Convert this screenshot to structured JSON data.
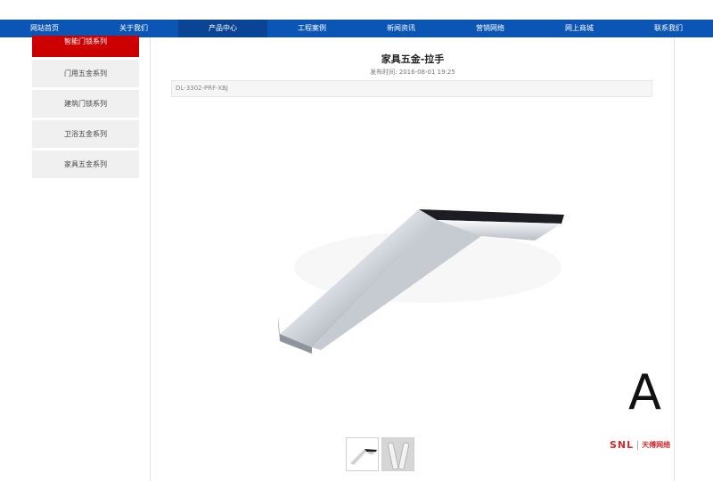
{
  "nav": {
    "items": [
      "网站首页",
      "关于我们",
      "产品中心",
      "工程案例",
      "新闻资讯",
      "营销网络",
      "网上商城",
      "联系我们"
    ],
    "active_index": 2
  },
  "sidebar": {
    "items": [
      {
        "label": "智能门锁系列",
        "active": true
      },
      {
        "label": "门用五金系列",
        "active": false
      },
      {
        "label": "建筑门锁系列",
        "active": false
      },
      {
        "label": "卫浴五金系列",
        "active": false
      },
      {
        "label": "家具五金系列",
        "active": false
      }
    ]
  },
  "article": {
    "title": "家具五金-拉手",
    "meta": "发布时间: 2016-08-01 19:25",
    "code": "DL-3302-PRF-XBJ"
  },
  "watermark": {
    "letter": "A",
    "logo_text": "SNL",
    "logo_cn": "天傅网络"
  },
  "colors": {
    "nav_bg": "#0b55b4",
    "nav_active": "#0a4494",
    "sidebar_active": "#cc0000",
    "logo_red": "#d4282a"
  },
  "icons": {
    "product_image": "handle-image",
    "thumbnail_1": "handle-thumbnail",
    "thumbnail_2": "handle-pair-thumbnail"
  }
}
